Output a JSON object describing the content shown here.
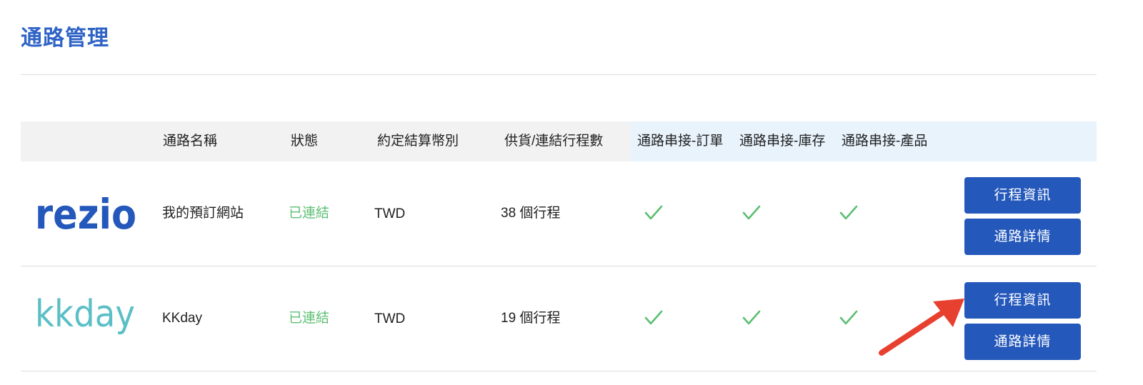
{
  "page": {
    "title": "通路管理"
  },
  "table": {
    "headers": {
      "channel_name": "通路名稱",
      "status": "狀態",
      "currency": "約定結算幣別",
      "trip_count": "供貨/連結行程數",
      "order_link": "通路串接-訂單",
      "stock_link": "通路串接-庫存",
      "product_link": "通路串接-產品"
    },
    "rows": [
      {
        "logo": "rezio-logo",
        "name": "我的預訂網站",
        "status": "已連結",
        "currency": "TWD",
        "trip_count": "38 個行程",
        "order_link": true,
        "stock_link": true,
        "product_link": true,
        "trip_info_label": "行程資訊",
        "details_label": "通路詳情"
      },
      {
        "logo": "kkday-logo",
        "name": "KKday",
        "status": "已連結",
        "currency": "TWD",
        "trip_count": "19 個行程",
        "order_link": true,
        "stock_link": true,
        "product_link": true,
        "trip_info_label": "行程資訊",
        "details_label": "通路詳情"
      }
    ]
  },
  "colors": {
    "title": "#2f63c6",
    "button": "#2458bb",
    "status_connected": "#5cbf72",
    "check": "#5cbf72",
    "rezio_logo": "#2458bb",
    "kkday_logo": "#5bbfc6",
    "annotation_arrow": "#e8402f"
  },
  "icons": {
    "check": "check-icon",
    "annotation": "red-arrow-annotation"
  }
}
